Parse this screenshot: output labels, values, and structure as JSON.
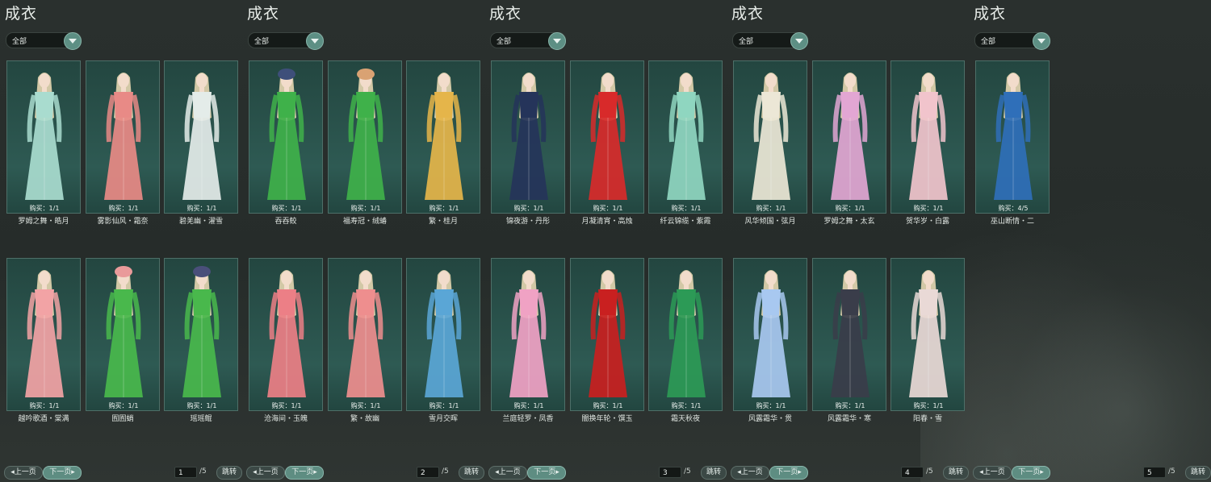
{
  "ui": {
    "title": "成衣",
    "filter_value": "全部",
    "prev_label": "上一页",
    "next_label": "下一页",
    "jump_label": "跳转",
    "total_pages_label": "/5"
  },
  "colors": {
    "card_bg": "#2e5a53",
    "accent": "#5e8d82",
    "background": "#2a302e"
  },
  "panels": [
    {
      "page": "1",
      "items": [
        {
          "name": "罗姆之舞・皓月",
          "buy": "购买：1/1",
          "outfit_color": "#a9dccf",
          "hat": ""
        },
        {
          "name": "雾影仙风・霜奈",
          "buy": "购买：1/1",
          "outfit_color": "#e88a86",
          "hat": ""
        },
        {
          "name": "碧羌幽・濯雪",
          "buy": "购买：1/1",
          "outfit_color": "#e4ece9",
          "hat": ""
        },
        {
          "name": "越吟歌酒・棠满",
          "buy": "购买：1/1",
          "outfit_color": "#f2a3a5",
          "hat": ""
        },
        {
          "name": "囿囿蛸",
          "buy": "购买：1/1",
          "outfit_color": "#49b84c",
          "hat": "#e99a9a"
        },
        {
          "name": "瑶瑶鲲",
          "buy": "购买：1/1",
          "outfit_color": "#49b84c",
          "hat": "#4a4f7a"
        }
      ]
    },
    {
      "page": "2",
      "items": [
        {
          "name": "吞吞鲛",
          "buy": "购买：1/1",
          "outfit_color": "#3fb14a",
          "hat": "#3e4f7a"
        },
        {
          "name": "福寿冠・绒蝽",
          "buy": "购买：1/1",
          "outfit_color": "#3fb14a",
          "hat": "#d9a273"
        },
        {
          "name": "繁・桂月",
          "buy": "购买：1/1",
          "outfit_color": "#e5b54a",
          "hat": ""
        },
        {
          "name": "沧海间・玉魄",
          "buy": "购买：1/1",
          "outfit_color": "#ec7f86",
          "hat": ""
        },
        {
          "name": "繁・故幽",
          "buy": "购买：1/1",
          "outfit_color": "#ee8e8e",
          "hat": ""
        },
        {
          "name": "雪月交晖",
          "buy": "购买：1/1",
          "outfit_color": "#5aa6d6",
          "hat": ""
        }
      ]
    },
    {
      "page": "3",
      "items": [
        {
          "name": "锦夜游・丹彤",
          "buy": "购买：1/1",
          "outfit_color": "#25345a",
          "hat": ""
        },
        {
          "name": "月凝清宵・高烛",
          "buy": "购买：1/1",
          "outfit_color": "#d82a2a",
          "hat": ""
        },
        {
          "name": "纤云锦缆・紫霞",
          "buy": "购买：1/1",
          "outfit_color": "#8fd6c0",
          "hat": ""
        },
        {
          "name": "兰庭轻罗・凤香",
          "buy": "购买：1/1",
          "outfit_color": "#f0a2c4",
          "hat": ""
        },
        {
          "name": "闇换年轮・馔玉",
          "buy": "购买：1/1",
          "outfit_color": "#c92020",
          "hat": ""
        },
        {
          "name": "霜天秋夜",
          "buy": "购买：1/1",
          "outfit_color": "#2c9a56",
          "hat": ""
        }
      ]
    },
    {
      "page": "4",
      "items": [
        {
          "name": "风华倾国・弦月",
          "buy": "购买：1/1",
          "outfit_color": "#ece7d6",
          "hat": ""
        },
        {
          "name": "罗姆之舞・太玄",
          "buy": "购买：1/1",
          "outfit_color": "#e2a6d3",
          "hat": ""
        },
        {
          "name": "贺华岁・白露",
          "buy": "购买：1/1",
          "outfit_color": "#f1c4cc",
          "hat": ""
        },
        {
          "name": "风露霜华・贯",
          "buy": "购买：1/1",
          "outfit_color": "#a8c8f0",
          "hat": ""
        },
        {
          "name": "风露霜华・寒",
          "buy": "购买：1/1",
          "outfit_color": "#3a3d4a",
          "hat": ""
        },
        {
          "name": "阳春・雪",
          "buy": "购买：1/1",
          "outfit_color": "#e9d9d6",
          "hat": ""
        }
      ]
    },
    {
      "page": "5",
      "items": [
        {
          "name": "巫山断情・二",
          "buy": "购买：4/5",
          "outfit_color": "#2f6fb9",
          "hat": ""
        }
      ]
    }
  ]
}
